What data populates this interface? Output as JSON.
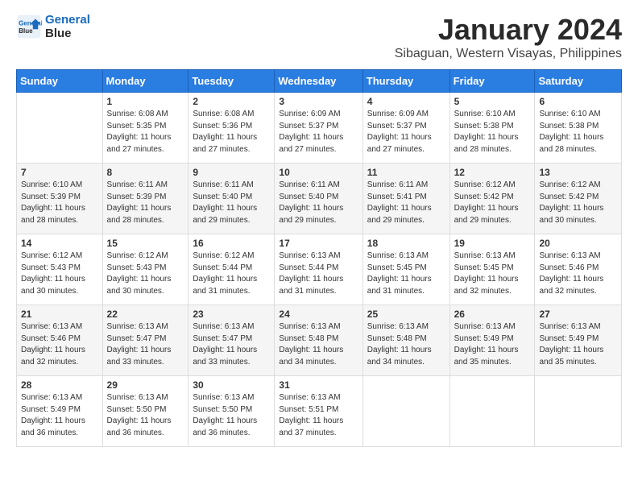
{
  "header": {
    "logo_line1": "General",
    "logo_line2": "Blue",
    "month_title": "January 2024",
    "subtitle": "Sibaguan, Western Visayas, Philippines"
  },
  "weekdays": [
    "Sunday",
    "Monday",
    "Tuesday",
    "Wednesday",
    "Thursday",
    "Friday",
    "Saturday"
  ],
  "weeks": [
    [
      {
        "day": "",
        "sunrise": "",
        "sunset": "",
        "daylight": ""
      },
      {
        "day": "1",
        "sunrise": "Sunrise: 6:08 AM",
        "sunset": "Sunset: 5:35 PM",
        "daylight": "Daylight: 11 hours and 27 minutes."
      },
      {
        "day": "2",
        "sunrise": "Sunrise: 6:08 AM",
        "sunset": "Sunset: 5:36 PM",
        "daylight": "Daylight: 11 hours and 27 minutes."
      },
      {
        "day": "3",
        "sunrise": "Sunrise: 6:09 AM",
        "sunset": "Sunset: 5:37 PM",
        "daylight": "Daylight: 11 hours and 27 minutes."
      },
      {
        "day": "4",
        "sunrise": "Sunrise: 6:09 AM",
        "sunset": "Sunset: 5:37 PM",
        "daylight": "Daylight: 11 hours and 27 minutes."
      },
      {
        "day": "5",
        "sunrise": "Sunrise: 6:10 AM",
        "sunset": "Sunset: 5:38 PM",
        "daylight": "Daylight: 11 hours and 28 minutes."
      },
      {
        "day": "6",
        "sunrise": "Sunrise: 6:10 AM",
        "sunset": "Sunset: 5:38 PM",
        "daylight": "Daylight: 11 hours and 28 minutes."
      }
    ],
    [
      {
        "day": "7",
        "sunrise": "Sunrise: 6:10 AM",
        "sunset": "Sunset: 5:39 PM",
        "daylight": "Daylight: 11 hours and 28 minutes."
      },
      {
        "day": "8",
        "sunrise": "Sunrise: 6:11 AM",
        "sunset": "Sunset: 5:39 PM",
        "daylight": "Daylight: 11 hours and 28 minutes."
      },
      {
        "day": "9",
        "sunrise": "Sunrise: 6:11 AM",
        "sunset": "Sunset: 5:40 PM",
        "daylight": "Daylight: 11 hours and 29 minutes."
      },
      {
        "day": "10",
        "sunrise": "Sunrise: 6:11 AM",
        "sunset": "Sunset: 5:40 PM",
        "daylight": "Daylight: 11 hours and 29 minutes."
      },
      {
        "day": "11",
        "sunrise": "Sunrise: 6:11 AM",
        "sunset": "Sunset: 5:41 PM",
        "daylight": "Daylight: 11 hours and 29 minutes."
      },
      {
        "day": "12",
        "sunrise": "Sunrise: 6:12 AM",
        "sunset": "Sunset: 5:42 PM",
        "daylight": "Daylight: 11 hours and 29 minutes."
      },
      {
        "day": "13",
        "sunrise": "Sunrise: 6:12 AM",
        "sunset": "Sunset: 5:42 PM",
        "daylight": "Daylight: 11 hours and 30 minutes."
      }
    ],
    [
      {
        "day": "14",
        "sunrise": "Sunrise: 6:12 AM",
        "sunset": "Sunset: 5:43 PM",
        "daylight": "Daylight: 11 hours and 30 minutes."
      },
      {
        "day": "15",
        "sunrise": "Sunrise: 6:12 AM",
        "sunset": "Sunset: 5:43 PM",
        "daylight": "Daylight: 11 hours and 30 minutes."
      },
      {
        "day": "16",
        "sunrise": "Sunrise: 6:12 AM",
        "sunset": "Sunset: 5:44 PM",
        "daylight": "Daylight: 11 hours and 31 minutes."
      },
      {
        "day": "17",
        "sunrise": "Sunrise: 6:13 AM",
        "sunset": "Sunset: 5:44 PM",
        "daylight": "Daylight: 11 hours and 31 minutes."
      },
      {
        "day": "18",
        "sunrise": "Sunrise: 6:13 AM",
        "sunset": "Sunset: 5:45 PM",
        "daylight": "Daylight: 11 hours and 31 minutes."
      },
      {
        "day": "19",
        "sunrise": "Sunrise: 6:13 AM",
        "sunset": "Sunset: 5:45 PM",
        "daylight": "Daylight: 11 hours and 32 minutes."
      },
      {
        "day": "20",
        "sunrise": "Sunrise: 6:13 AM",
        "sunset": "Sunset: 5:46 PM",
        "daylight": "Daylight: 11 hours and 32 minutes."
      }
    ],
    [
      {
        "day": "21",
        "sunrise": "Sunrise: 6:13 AM",
        "sunset": "Sunset: 5:46 PM",
        "daylight": "Daylight: 11 hours and 32 minutes."
      },
      {
        "day": "22",
        "sunrise": "Sunrise: 6:13 AM",
        "sunset": "Sunset: 5:47 PM",
        "daylight": "Daylight: 11 hours and 33 minutes."
      },
      {
        "day": "23",
        "sunrise": "Sunrise: 6:13 AM",
        "sunset": "Sunset: 5:47 PM",
        "daylight": "Daylight: 11 hours and 33 minutes."
      },
      {
        "day": "24",
        "sunrise": "Sunrise: 6:13 AM",
        "sunset": "Sunset: 5:48 PM",
        "daylight": "Daylight: 11 hours and 34 minutes."
      },
      {
        "day": "25",
        "sunrise": "Sunrise: 6:13 AM",
        "sunset": "Sunset: 5:48 PM",
        "daylight": "Daylight: 11 hours and 34 minutes."
      },
      {
        "day": "26",
        "sunrise": "Sunrise: 6:13 AM",
        "sunset": "Sunset: 5:49 PM",
        "daylight": "Daylight: 11 hours and 35 minutes."
      },
      {
        "day": "27",
        "sunrise": "Sunrise: 6:13 AM",
        "sunset": "Sunset: 5:49 PM",
        "daylight": "Daylight: 11 hours and 35 minutes."
      }
    ],
    [
      {
        "day": "28",
        "sunrise": "Sunrise: 6:13 AM",
        "sunset": "Sunset: 5:49 PM",
        "daylight": "Daylight: 11 hours and 36 minutes."
      },
      {
        "day": "29",
        "sunrise": "Sunrise: 6:13 AM",
        "sunset": "Sunset: 5:50 PM",
        "daylight": "Daylight: 11 hours and 36 minutes."
      },
      {
        "day": "30",
        "sunrise": "Sunrise: 6:13 AM",
        "sunset": "Sunset: 5:50 PM",
        "daylight": "Daylight: 11 hours and 36 minutes."
      },
      {
        "day": "31",
        "sunrise": "Sunrise: 6:13 AM",
        "sunset": "Sunset: 5:51 PM",
        "daylight": "Daylight: 11 hours and 37 minutes."
      },
      {
        "day": "",
        "sunrise": "",
        "sunset": "",
        "daylight": ""
      },
      {
        "day": "",
        "sunrise": "",
        "sunset": "",
        "daylight": ""
      },
      {
        "day": "",
        "sunrise": "",
        "sunset": "",
        "daylight": ""
      }
    ]
  ]
}
